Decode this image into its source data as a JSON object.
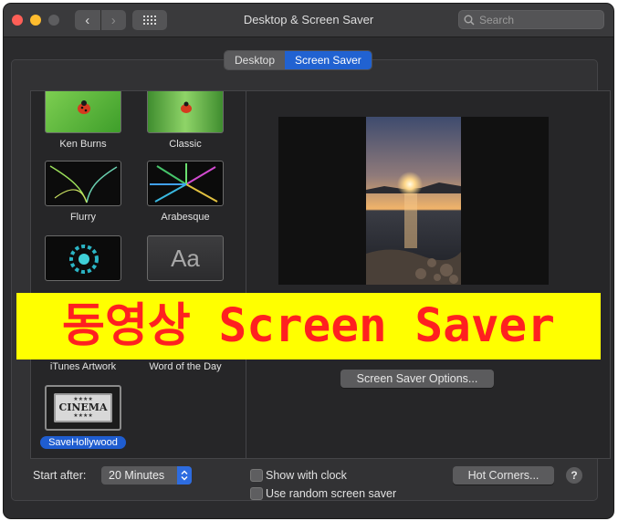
{
  "window": {
    "title": "Desktop & Screen Saver"
  },
  "search": {
    "placeholder": "Search"
  },
  "tabs": [
    {
      "label": "Desktop",
      "active": false
    },
    {
      "label": "Screen Saver",
      "active": true
    }
  ],
  "savers": [
    {
      "label": "Ken Burns",
      "icon": "ladybug-leaf-thumbnail"
    },
    {
      "label": "Classic",
      "icon": "ladybug-leaf-thumbnail"
    },
    {
      "label": "Flurry",
      "icon": "flurry-thumbnail"
    },
    {
      "label": "Arabesque",
      "icon": "arabesque-thumbnail"
    },
    {
      "label": "",
      "icon": "shell-thumbnail"
    },
    {
      "label": "",
      "icon": "message-thumbnail",
      "glyph": "Aa"
    },
    {
      "label": "iTunes Artwork",
      "icon": ""
    },
    {
      "label": "Word of the Day",
      "icon": ""
    },
    {
      "label": "SaveHollywood",
      "icon": "cinema-ticket-thumbnail",
      "ticket_text": "CINEMA",
      "selected": true
    }
  ],
  "overlay_banner": "동영상 Screen Saver",
  "preview": {
    "options_button": "Screen Saver Options..."
  },
  "bottom": {
    "start_after_label": "Start after:",
    "start_after_value": "20 Minutes",
    "show_clock_label": "Show with clock",
    "random_label": "Use random screen saver",
    "hot_corners_button": "Hot Corners...",
    "help_button": "?"
  },
  "colors": {
    "accent": "#2162d1",
    "banner_bg": "#ffff00",
    "banner_text": "#ff2020"
  }
}
